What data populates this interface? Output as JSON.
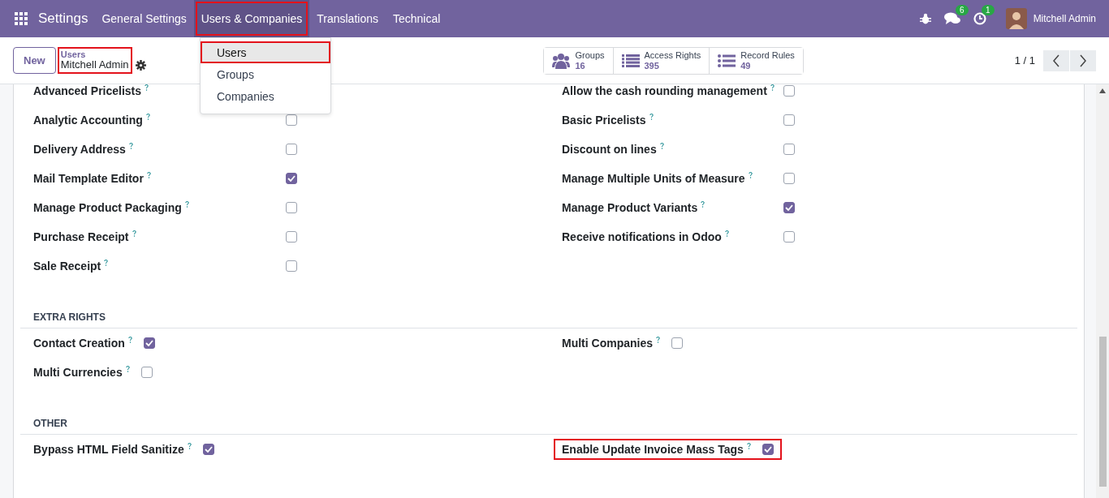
{
  "navbar": {
    "app_title": "Settings",
    "menu": [
      {
        "label": "General Settings",
        "selected": false,
        "highlighted": false
      },
      {
        "label": "Users & Companies",
        "selected": true,
        "highlighted": true
      },
      {
        "label": "Translations",
        "selected": false,
        "highlighted": false
      },
      {
        "label": "Technical",
        "selected": false,
        "highlighted": false
      }
    ],
    "messages_badge": "6",
    "activities_badge": "1",
    "user_name": "Mitchell Admin"
  },
  "dropdown": [
    {
      "label": "Users",
      "selected": true,
      "highlighted": true
    },
    {
      "label": "Groups",
      "selected": false,
      "highlighted": false
    },
    {
      "label": "Companies",
      "selected": false,
      "highlighted": false
    }
  ],
  "control_panel": {
    "new_button": "New",
    "breadcrumb": {
      "parent": "Users",
      "current": "Mitchell Admin",
      "highlighted": true
    },
    "stat_buttons": [
      {
        "kind": "groups",
        "label": "Groups",
        "value": "16"
      },
      {
        "kind": "list",
        "label": "Access Rights",
        "value": "395"
      },
      {
        "kind": "bullets",
        "label": "Record Rules",
        "value": "49"
      }
    ],
    "pager": "1 / 1"
  },
  "sections": [
    {
      "kind": "grid",
      "left": [
        {
          "label": "Advanced Pricelists",
          "highlighted": false
        },
        {
          "label": "Analytic Accounting",
          "checked": false,
          "highlighted": false
        },
        {
          "label": "Delivery Address",
          "checked": false,
          "highlighted": false
        },
        {
          "label": "Mail Template Editor",
          "checked": true,
          "highlighted": false
        },
        {
          "label": "Manage Product Packaging",
          "checked": false,
          "highlighted": false
        },
        {
          "label": "Purchase Receipt",
          "checked": false,
          "highlighted": false
        },
        {
          "label": "Sale Receipt",
          "checked": false,
          "highlighted": false
        }
      ],
      "right": [
        {
          "label": "Allow the cash rounding management",
          "checked": false,
          "highlighted": false
        },
        {
          "label": "Basic Pricelists",
          "checked": false,
          "highlighted": false
        },
        {
          "label": "Discount on lines",
          "checked": false,
          "highlighted": false
        },
        {
          "label": "Manage Multiple Units of Measure",
          "checked": false,
          "highlighted": false
        },
        {
          "label": "Manage Product Variants",
          "checked": true,
          "highlighted": false
        },
        {
          "label": "Receive notifications in Odoo",
          "checked": false,
          "highlighted": false
        }
      ]
    },
    {
      "kind": "inline",
      "heading": "EXTRA RIGHTS",
      "left": [
        {
          "label": "Contact Creation",
          "checked": true,
          "highlighted": false
        },
        {
          "label": "Multi Currencies",
          "checked": false,
          "highlighted": false
        }
      ],
      "right": [
        {
          "label": "Multi Companies",
          "checked": false,
          "highlighted": false
        }
      ]
    },
    {
      "kind": "inline",
      "heading": "OTHER",
      "left": [
        {
          "label": "Bypass HTML Field Sanitize",
          "checked": true,
          "highlighted": false
        }
      ],
      "right": [
        {
          "label": "Enable Update Invoice Mass Tags",
          "checked": true,
          "highlighted": true
        }
      ]
    }
  ]
}
